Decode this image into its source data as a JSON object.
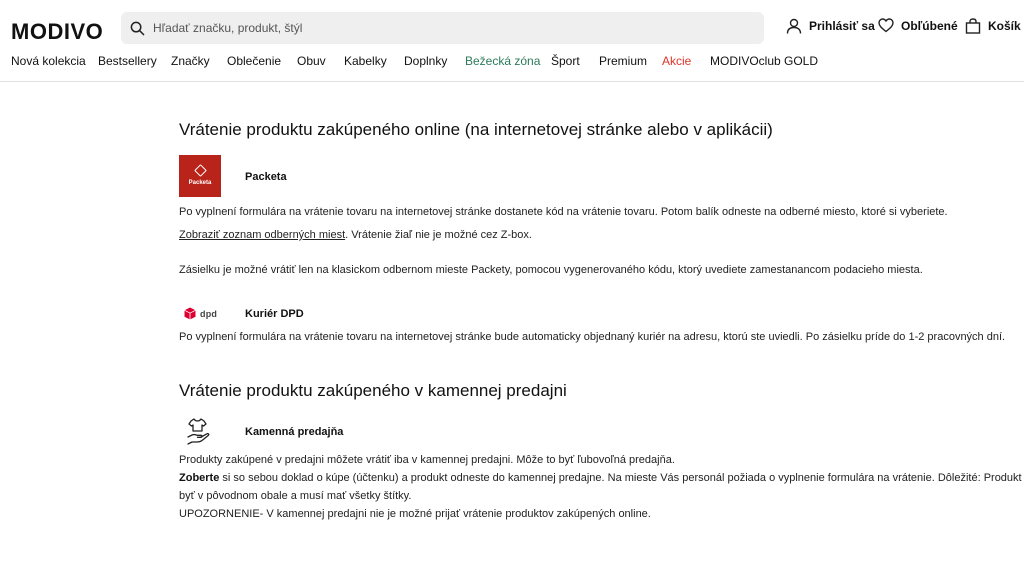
{
  "header": {
    "logo": "MODIVO",
    "search_placeholder": "Hľadať značku, produkt, štýl",
    "login": "Prihlásiť sa",
    "favorites": "Obľúbené",
    "cart": "Košík"
  },
  "nav": {
    "items": [
      "Nová kolekcia",
      "Bestsellery",
      "Značky",
      "Oblečenie",
      "Obuv",
      "Kabelky",
      "Doplnky",
      "Bežecká zóna",
      "Šport",
      "Premium",
      "Akcie",
      "MODIVOclub GOLD"
    ]
  },
  "colors": {
    "accent_green": "#2c7a5b",
    "accent_red": "#e0342a",
    "packeta_red": "#b8241a",
    "dpd_red": "#dc0032"
  },
  "online_section": {
    "title": "Vrátenie produktu zakúpeného online (na internetovej stránke alebo v aplikácii)",
    "packeta": {
      "logo_text": "Packeta",
      "name": "Packeta",
      "text1": "Po vyplnení formulára na vrátenie tovaru na internetovej stránke dostanete kód na vrátenie tovaru. Potom balík odneste na odberné miesto, ktoré si vyberiete.",
      "link": "Zobraziť zoznam odberných miest",
      "text2": ". Vrátenie žiaľ nie je možné cez Z-box.",
      "text3": "Zásielku je možné vrátiť len na klasickom odbernom mieste Packety, pomocou vygenerovaného kódu, ktorý uvediete zamestanancom podacieho miesta."
    },
    "dpd": {
      "logo_text": "dpd",
      "name": "Kuriér DPD",
      "text": "Po vyplnení formulára na vrátenie tovaru na internetovej stránke bude automaticky objednaný kuriér na adresu, ktorú ste uviedli. Po zásielku príde do 1-2 pracovných dní."
    }
  },
  "store_section": {
    "title": "Vrátenie produktu zakúpeného v kamennej predajni",
    "name": "Kamenná predajňa",
    "line1": "Produkty zakúpené v predajni môžete vrátiť iba v kamennej predajni. Môže to byť ľubovoľná predajňa.",
    "line2_bold": "Zoberte",
    "line2_rest": " si so sebou doklad o kúpe (účtenku) a produkt odneste do kamennej predajne. Na mieste Vás personál požiada o vyplnenie formulára na vrátenie. Dôležité: Produkt musí",
    "line3": "byť v pôvodnom obale a musí mať všetky štítky.",
    "line4": "UPOZORNENIE- V kamennej predajni nie je možné prijať vrátenie produktov zakúpených online."
  },
  "icons": {
    "search": "search-icon",
    "user": "user-icon",
    "heart": "heart-icon",
    "cart": "cart-icon",
    "dpd_cube": "dpd-cube-icon",
    "store": "tshirt-hand-icon"
  }
}
